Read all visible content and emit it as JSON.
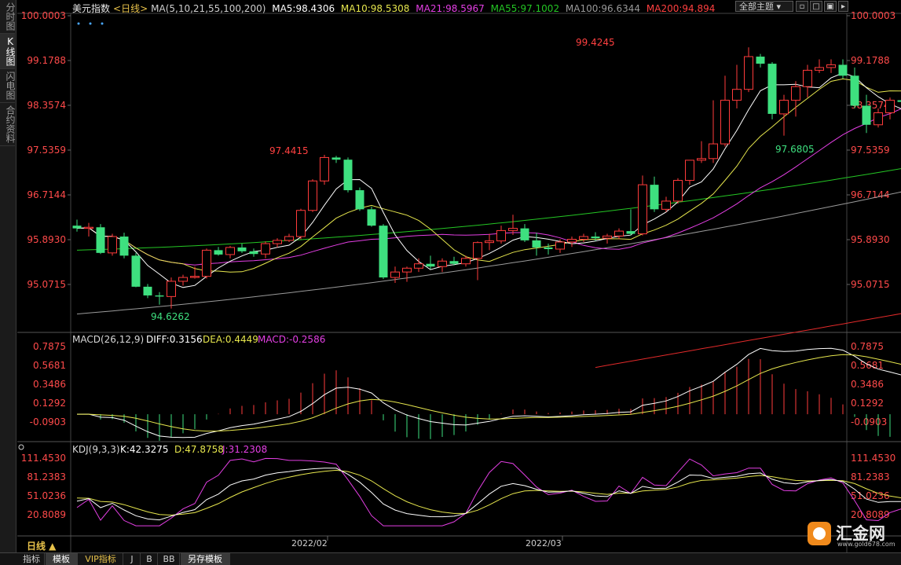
{
  "sidebar": {
    "tabs": [
      "分时图",
      "K线图",
      "闪电图",
      "合约资料"
    ],
    "active_tab": 1
  },
  "header": {
    "symbol": "美元指数",
    "period": "<日线>",
    "ma_label": "MA(5,10,21,55,100,200)",
    "ma5": "MA5:98.4306",
    "ma10": "MA10:98.5308",
    "ma21": "MA21:98.5967",
    "ma55": "MA55:97.1002",
    "ma100": "MA100:96.6344",
    "ma200": "MA200:94.894",
    "theme_button": "全部主题"
  },
  "colors": {
    "up": "#ff3b3b",
    "down": "#3ee07f",
    "ma5": "#ffffff",
    "ma10": "#e6e64d",
    "ma21": "#e43fe4",
    "ma55": "#24c624",
    "ma100": "#9a9a9a",
    "ma200": "#e22a2a"
  },
  "price_axis": {
    "labels": [
      "100.0003",
      "99.1788",
      "98.3574",
      "97.5359",
      "96.7144",
      "95.8930",
      "95.0715"
    ]
  },
  "price_annotations": {
    "high": "99.4245",
    "low": "97.6805",
    "peak1": "97.4415",
    "trough1": "94.6262"
  },
  "macd": {
    "label": "MACD(26,12,9)",
    "diff": "DIFF:0.3156",
    "dea": "DEA:0.4449",
    "macd": "MACD:-0.2586",
    "axis_labels": [
      "0.7875",
      "0.5681",
      "0.3486",
      "0.1292",
      "-0.0903"
    ]
  },
  "kdj": {
    "label": "KDJ(9,3,3)",
    "k": "K:42.3275",
    "d": "D:47.8758",
    "j": "J:31.2308",
    "axis_labels": [
      "111.4530",
      "81.2383",
      "51.0236",
      "20.8089"
    ]
  },
  "x_axis": {
    "labels": [
      "2022/02",
      "2022/03"
    ]
  },
  "period_label": "日线 ▲",
  "footer_tabs": [
    "指标",
    "模板",
    "VIP指标",
    "J",
    "B",
    "BB",
    "另存模板"
  ],
  "logo": {
    "text": "汇金网",
    "url": "www.gold678.com"
  },
  "chart_data": {
    "type": "candlestick",
    "candles": [
      {
        "o": 96.15,
        "h": 96.26,
        "l": 96.04,
        "c": 96.1
      },
      {
        "o": 96.1,
        "h": 96.2,
        "l": 95.95,
        "c": 96.12
      },
      {
        "o": 96.12,
        "h": 96.18,
        "l": 95.63,
        "c": 95.65
      },
      {
        "o": 95.65,
        "h": 96.0,
        "l": 95.6,
        "c": 95.95
      },
      {
        "o": 95.95,
        "h": 96.02,
        "l": 95.55,
        "c": 95.6
      },
      {
        "o": 95.6,
        "h": 95.65,
        "l": 95.02,
        "c": 95.03
      },
      {
        "o": 95.03,
        "h": 95.08,
        "l": 94.82,
        "c": 94.87
      },
      {
        "o": 94.87,
        "h": 94.93,
        "l": 94.7,
        "c": 94.85
      },
      {
        "o": 94.85,
        "h": 95.2,
        "l": 94.63,
        "c": 95.13
      },
      {
        "o": 95.13,
        "h": 95.25,
        "l": 95.05,
        "c": 95.2
      },
      {
        "o": 95.2,
        "h": 95.4,
        "l": 95.18,
        "c": 95.22
      },
      {
        "o": 95.22,
        "h": 95.73,
        "l": 95.18,
        "c": 95.7
      },
      {
        "o": 95.7,
        "h": 95.76,
        "l": 95.6,
        "c": 95.62
      },
      {
        "o": 95.62,
        "h": 95.78,
        "l": 95.55,
        "c": 95.75
      },
      {
        "o": 95.75,
        "h": 95.82,
        "l": 95.65,
        "c": 95.68
      },
      {
        "o": 95.68,
        "h": 95.73,
        "l": 95.58,
        "c": 95.63
      },
      {
        "o": 95.63,
        "h": 95.86,
        "l": 95.55,
        "c": 95.82
      },
      {
        "o": 95.82,
        "h": 95.92,
        "l": 95.75,
        "c": 95.88
      },
      {
        "o": 95.88,
        "h": 96.0,
        "l": 95.85,
        "c": 95.95
      },
      {
        "o": 95.95,
        "h": 96.46,
        "l": 95.9,
        "c": 96.43
      },
      {
        "o": 96.43,
        "h": 97.0,
        "l": 96.4,
        "c": 96.97
      },
      {
        "o": 96.97,
        "h": 97.45,
        "l": 96.9,
        "c": 97.4
      },
      {
        "o": 97.4,
        "h": 97.43,
        "l": 97.3,
        "c": 97.36
      },
      {
        "o": 97.36,
        "h": 97.4,
        "l": 96.76,
        "c": 96.8
      },
      {
        "o": 96.8,
        "h": 96.85,
        "l": 96.42,
        "c": 96.45
      },
      {
        "o": 96.45,
        "h": 96.5,
        "l": 96.13,
        "c": 96.15
      },
      {
        "o": 96.15,
        "h": 96.18,
        "l": 95.17,
        "c": 95.2
      },
      {
        "o": 95.2,
        "h": 95.4,
        "l": 95.1,
        "c": 95.3
      },
      {
        "o": 95.3,
        "h": 95.4,
        "l": 95.12,
        "c": 95.37
      },
      {
        "o": 95.37,
        "h": 95.55,
        "l": 95.3,
        "c": 95.45
      },
      {
        "o": 95.45,
        "h": 95.6,
        "l": 95.35,
        "c": 95.4
      },
      {
        "o": 95.4,
        "h": 95.55,
        "l": 95.3,
        "c": 95.5
      },
      {
        "o": 95.5,
        "h": 95.58,
        "l": 95.42,
        "c": 95.45
      },
      {
        "o": 95.45,
        "h": 95.6,
        "l": 95.4,
        "c": 95.55
      },
      {
        "o": 95.55,
        "h": 95.86,
        "l": 95.15,
        "c": 95.84
      },
      {
        "o": 95.84,
        "h": 96.0,
        "l": 95.7,
        "c": 95.87
      },
      {
        "o": 95.87,
        "h": 96.15,
        "l": 95.82,
        "c": 96.06
      },
      {
        "o": 96.06,
        "h": 96.35,
        "l": 95.98,
        "c": 96.1
      },
      {
        "o": 96.1,
        "h": 96.18,
        "l": 95.85,
        "c": 95.88
      },
      {
        "o": 95.88,
        "h": 96.02,
        "l": 95.6,
        "c": 95.75
      },
      {
        "o": 95.75,
        "h": 95.82,
        "l": 95.62,
        "c": 95.72
      },
      {
        "o": 95.72,
        "h": 95.9,
        "l": 95.65,
        "c": 95.85
      },
      {
        "o": 95.85,
        "h": 95.95,
        "l": 95.76,
        "c": 95.9
      },
      {
        "o": 95.9,
        "h": 96.0,
        "l": 95.85,
        "c": 95.95
      },
      {
        "o": 95.95,
        "h": 96.03,
        "l": 95.87,
        "c": 95.92
      },
      {
        "o": 95.92,
        "h": 96.0,
        "l": 95.82,
        "c": 95.96
      },
      {
        "o": 95.96,
        "h": 96.1,
        "l": 95.9,
        "c": 96.05
      },
      {
        "o": 96.05,
        "h": 96.45,
        "l": 95.97,
        "c": 96.0
      },
      {
        "o": 96.0,
        "h": 97.07,
        "l": 95.97,
        "c": 96.9
      },
      {
        "o": 96.9,
        "h": 97.05,
        "l": 96.4,
        "c": 96.45
      },
      {
        "o": 96.45,
        "h": 96.68,
        "l": 96.4,
        "c": 96.6
      },
      {
        "o": 96.6,
        "h": 97.02,
        "l": 96.55,
        "c": 96.98
      },
      {
        "o": 96.98,
        "h": 97.25,
        "l": 96.9,
        "c": 97.35
      },
      {
        "o": 97.35,
        "h": 97.7,
        "l": 97.3,
        "c": 97.38
      },
      {
        "o": 97.38,
        "h": 98.45,
        "l": 97.3,
        "c": 97.65
      },
      {
        "o": 97.65,
        "h": 98.9,
        "l": 97.6,
        "c": 98.45
      },
      {
        "o": 98.45,
        "h": 99.1,
        "l": 98.3,
        "c": 98.65
      },
      {
        "o": 98.65,
        "h": 99.42,
        "l": 98.6,
        "c": 99.25
      },
      {
        "o": 99.25,
        "h": 99.3,
        "l": 99.05,
        "c": 99.12
      },
      {
        "o": 99.12,
        "h": 99.15,
        "l": 98.1,
        "c": 98.2
      },
      {
        "o": 98.2,
        "h": 98.55,
        "l": 97.8,
        "c": 98.45
      },
      {
        "o": 98.45,
        "h": 98.8,
        "l": 98.15,
        "c": 98.7
      },
      {
        "o": 98.7,
        "h": 99.1,
        "l": 98.5,
        "c": 99.0
      },
      {
        "o": 99.0,
        "h": 99.2,
        "l": 98.95,
        "c": 99.05
      },
      {
        "o": 99.05,
        "h": 99.2,
        "l": 98.95,
        "c": 99.1
      },
      {
        "o": 99.1,
        "h": 99.2,
        "l": 98.85,
        "c": 98.9
      },
      {
        "o": 98.9,
        "h": 99.05,
        "l": 98.3,
        "c": 98.35
      },
      {
        "o": 98.35,
        "h": 98.55,
        "l": 97.85,
        "c": 98.0
      },
      {
        "o": 98.0,
        "h": 98.3,
        "l": 97.95,
        "c": 98.22
      },
      {
        "o": 98.22,
        "h": 98.5,
        "l": 98.1,
        "c": 98.45
      },
      {
        "o": 98.45,
        "h": 98.7,
        "l": 98.3,
        "c": 98.42
      },
      {
        "o": 98.42,
        "h": 98.7,
        "l": 98.35,
        "c": 98.6
      },
      {
        "o": 98.6,
        "h": 98.8,
        "l": 98.45,
        "c": 98.58
      },
      {
        "o": 98.58,
        "h": 98.9,
        "l": 98.55,
        "c": 98.85
      },
      {
        "o": 98.85,
        "h": 99.1,
        "l": 98.8,
        "c": 98.9
      },
      {
        "o": 98.9,
        "h": 99.25,
        "l": 98.88,
        "c": 99.2
      },
      {
        "o": 99.2,
        "h": 99.25,
        "l": 98.35,
        "c": 98.4
      },
      {
        "o": 98.4,
        "h": 98.45,
        "l": 97.8,
        "c": 97.83
      },
      {
        "o": 97.83,
        "h": 98.4,
        "l": 97.72,
        "c": 98.3
      },
      {
        "o": 98.3,
        "h": 98.35,
        "l": 98.22,
        "c": 98.28
      }
    ]
  }
}
